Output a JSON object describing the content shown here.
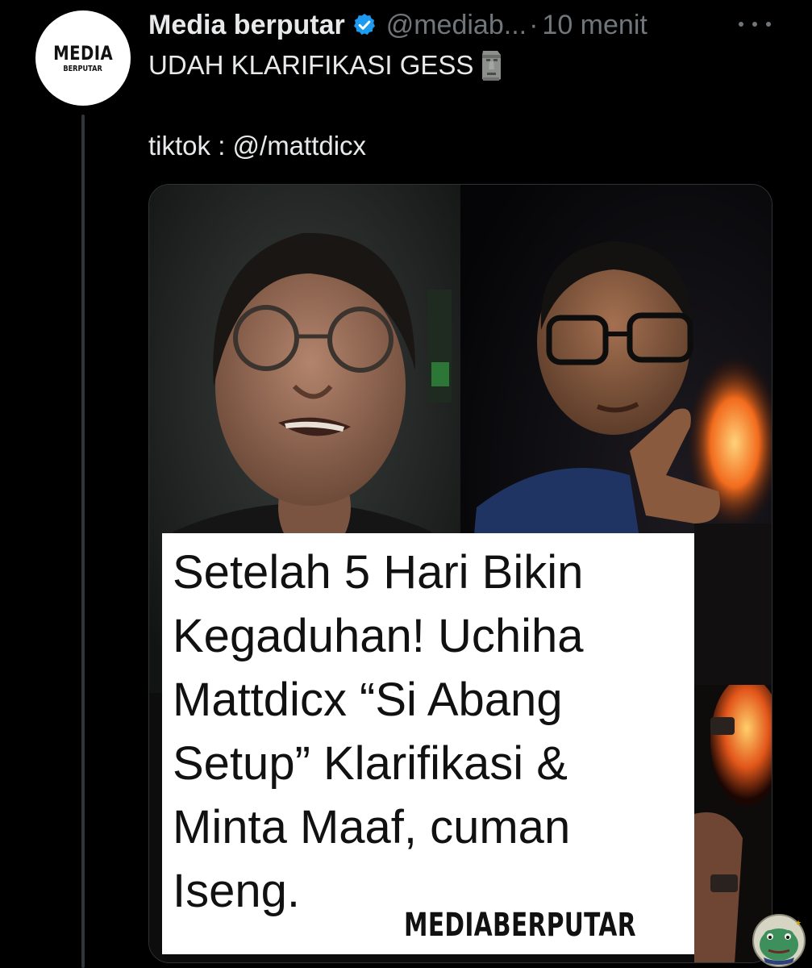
{
  "author": {
    "avatar_line1": "MEDIA",
    "avatar_line2": "BERPUTAR",
    "display_name": "Media berputar",
    "verified_icon": "verified-badge-icon",
    "handle": "@mediab...",
    "separator": "·",
    "time": "10 menit"
  },
  "tweet": {
    "line1": "UDAH KLARIFIKASI GESS",
    "line1_emoji": "moai-icon",
    "line2": "tiktok : @/mattdicx"
  },
  "media": {
    "caption_lines": [
      "Setelah 5 Hari Bikin",
      "Kegaduhan! Uchiha",
      "Mattdicx “Si Abang",
      "Setup” Klarifikasi &",
      "Minta Maaf, cuman",
      "Iseng."
    ],
    "watermark": "MEDIABERPUTAR"
  },
  "icons": {
    "more": "more-options-icon",
    "sticker": "frog-sticker-icon"
  },
  "colors": {
    "background": "#000000",
    "text_primary": "#e7e9ea",
    "text_secondary": "#71767b",
    "verified": "#1d9bf0",
    "thread_line": "#333639"
  }
}
